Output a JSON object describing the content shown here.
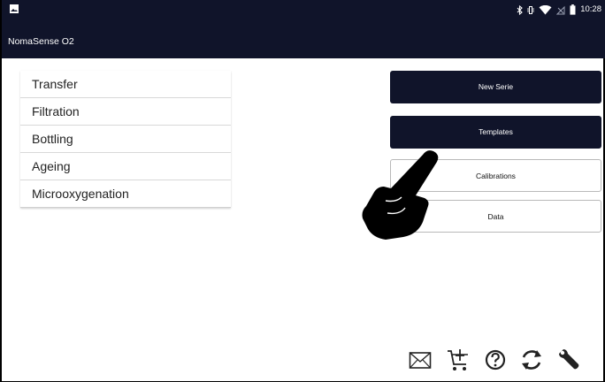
{
  "status_bar": {
    "time": "10:28",
    "icons": [
      "image-icon",
      "bluetooth-icon",
      "vibrate-icon",
      "wifi-icon",
      "no-signal-icon",
      "battery-icon"
    ]
  },
  "app_bar": {
    "title": "NomaSense O2",
    "color": "#10142a"
  },
  "menu_list": {
    "items": [
      {
        "label": "Transfer"
      },
      {
        "label": "Filtration"
      },
      {
        "label": "Bottling"
      },
      {
        "label": "Ageing"
      },
      {
        "label": "Microoxygenation"
      }
    ]
  },
  "action_buttons": {
    "new_serie": "New Serie",
    "templates": "Templates",
    "calibrations": "Calibrations",
    "data": "Data"
  },
  "bottom_toolbar": {
    "icons": [
      "mail-icon",
      "cart-icon",
      "help-icon",
      "sync-icon",
      "wrench-icon"
    ]
  },
  "overlay": {
    "icon": "pointing-hand-icon"
  }
}
